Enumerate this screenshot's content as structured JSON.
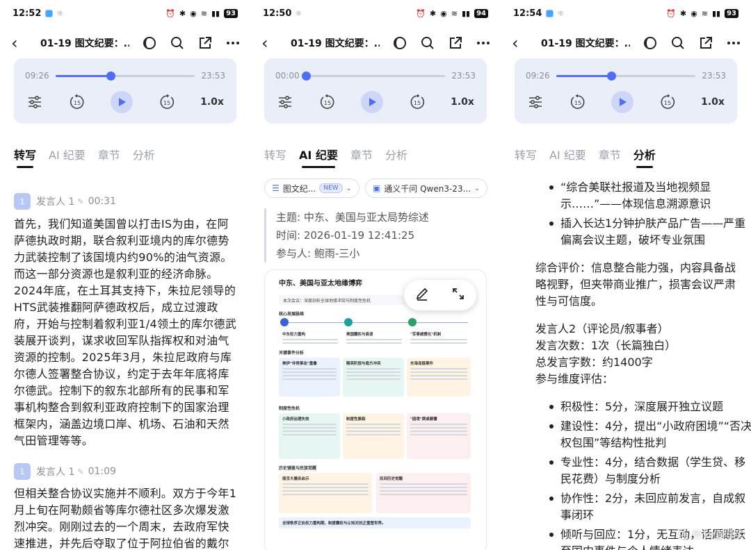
{
  "screens": [
    {
      "status": {
        "time": "12:52",
        "battery": "93"
      },
      "topbar": {
        "title": "01-19 图文纪要：..."
      },
      "player": {
        "elapsed": "09:26",
        "total": "23:53",
        "speed": "1.0x",
        "progress": 0.395
      },
      "tabs": [
        "转写",
        "AI 纪要",
        "章节",
        "分析"
      ],
      "active_tab": 0,
      "transcript": [
        {
          "avatar": "1",
          "speaker": "发言人 1",
          "time": "00:31",
          "text": "首先，我们知道美国曾以打击IS为由，在阿萨德执政时期，联合叙利亚境内的库尔德势力武装控制了该国境内约90%的油气资源。而这一部分资源也是叙利亚的经济命脉。2024年底，在土耳其支持下，朱拉尼领导的HTS武装推翻阿萨德政权后，成立过渡政府，开始与控制着叙利亚1/4领土的库尔德武装展开谈判，谋求收回军队指挥权和对油气资源的控制。2025年3月，朱拉尼政府与库尔德人签署整合协议，约定于去年年底将库尔德武。控制下的叙东北部所有的民事和军事机构整合到叙利亚政府控制下的国家治理框架内，涵盖边境口岸、机场、石油和天然气田管理等等。"
        },
        {
          "avatar": "1",
          "speaker": "发言人 1",
          "time": "01:09",
          "text": "但相关整合协议实施并不顺利。双方于今年1月上旬在阿勒颇省等库尔德社区多次爆发激烈冲突。刚刚过去的一个周末，去政府军快速推进，并先后夺取了位于阿拉伯省的戴尔哈菲尔"
        }
      ]
    },
    {
      "status": {
        "time": "12:50",
        "battery": "94"
      },
      "topbar": {
        "title": "01-19 图文纪要：..."
      },
      "player": {
        "elapsed": "00:00",
        "total": "23:53",
        "speed": "1.0x",
        "progress": 0.0
      },
      "tabs": [
        "转写",
        "AI 纪要",
        "章节",
        "分析"
      ],
      "active_tab": 1,
      "chips": {
        "template": "图文纪...",
        "template_badge": "NEW",
        "model": "通义千问 Qwen3-23..."
      },
      "meta": {
        "topic": "主题: 中东、美国与亚太局势综述",
        "time": "时间: 2026-01-19 12:41:25",
        "participants": "参与人: 鲍雨-三小"
      },
      "infographic": {
        "title": "中东、美国与亚太地缘博弈",
        "subtitle": "本次会议：深度剖析全球地缘冲突与制度性危机",
        "section1": "核心发展脉络",
        "node1": "中东权力重构",
        "node2": "美国霸权与衰退",
        "node3": "\"军事威慑化\"机制",
        "section2": "关键事件分析",
        "event1": "美伊\"非常事态\"重叠",
        "event2": "精英阶层与南方冲突",
        "event3": "东海岛链事件",
        "section3": "制度性危机",
        "crisis1": "小政府治理失效",
        "crisis2": "制度性撕裂",
        "crisis3": "\"困境\"牌桌颠覆",
        "section4": "历史镜鉴与民族觉醒",
        "history1": "南京大屠杀启示",
        "history2": "民间历史觉醒",
        "footer": "全球秩序正处权力重构期，制度霸权与认知对抗正重塑世界。"
      }
    },
    {
      "status": {
        "time": "12:54",
        "battery": "93"
      },
      "topbar": {
        "title": "01-19 图文纪要：..."
      },
      "player": {
        "elapsed": "09:26",
        "total": "23:53",
        "speed": "1.0x",
        "progress": 0.395
      },
      "tabs": [
        "转写",
        "AI 纪要",
        "章节",
        "分析"
      ],
      "active_tab": 3,
      "bullets_top": [
        "“综合美联社报道及当地视频显示……”——体现信息溯源意识",
        "插入长达1分钟护肤产品广告——严重偏离会议主题，破坏专业氛围"
      ],
      "summary": "综合评价：信息整合能力强，内容具备战略视野，但夹带商业推广，损害会议严肃性与可信度。",
      "speaker2": [
        "发言人2（评论员/叙事者）",
        "发言次数：1次（长篇独白）",
        "总发言字数：约1400字",
        "参与维度评估："
      ],
      "bullets_bottom": [
        "积极性：5分，深度展开独立议题",
        "建设性：4分，提出“小政府困境”“否决权包围”等结构性批判",
        "专业性：4分，结合数据（学生贷、移民花费）与制度分析",
        "协作性：2分，未回应前发言，自成叙事闭环",
        "倾听与回应：1分，无互动，话题跳跃至国内事件与个人情绪表达"
      ],
      "watermark": "值 什么值得买"
    }
  ]
}
